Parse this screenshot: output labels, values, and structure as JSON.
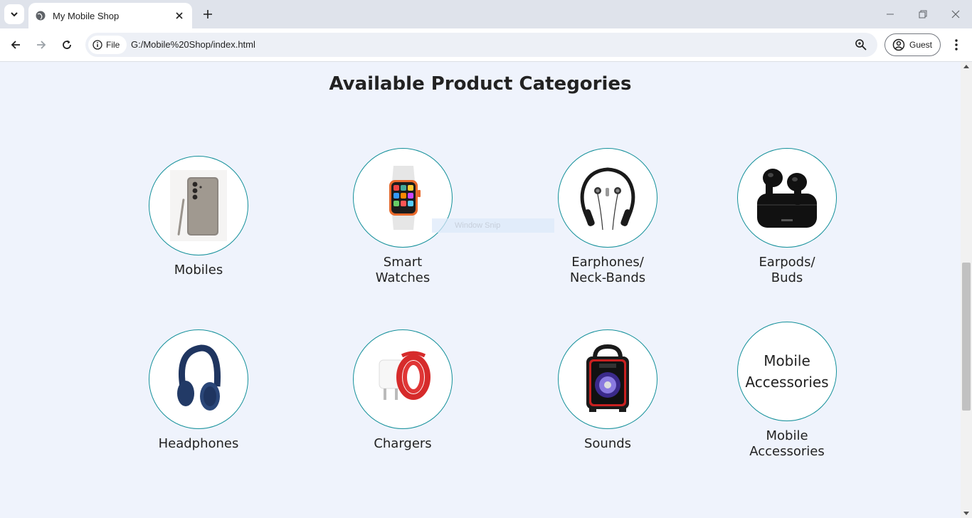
{
  "browser": {
    "tab_title": "My Mobile Shop",
    "file_chip": "File",
    "url": "G:/Mobile%20Shop/index.html",
    "profile_label": "Guest"
  },
  "page": {
    "heading": "Available Product Categories",
    "snip_overlay": "Window Snip",
    "categories": [
      {
        "label_line1": "Mobiles",
        "label_line2": "",
        "icon": "phone-icon"
      },
      {
        "label_line1": "Smart",
        "label_line2": "Watches",
        "icon": "smartwatch-icon"
      },
      {
        "label_line1": "Earphones/",
        "label_line2": "Neck-Bands",
        "icon": "neckband-icon"
      },
      {
        "label_line1": "Earpods/",
        "label_line2": "Buds",
        "icon": "earbuds-icon"
      },
      {
        "label_line1": "Headphones",
        "label_line2": "",
        "icon": "headphones-icon"
      },
      {
        "label_line1": "Chargers",
        "label_line2": "",
        "icon": "charger-icon"
      },
      {
        "label_line1": "Sounds",
        "label_line2": "",
        "icon": "speaker-icon"
      },
      {
        "label_line1": "Mobile",
        "label_line2": "Accessories",
        "circle_line1": "Mobile",
        "circle_line2": "Accessories"
      }
    ]
  },
  "colors": {
    "page_bg": "#eff3fc",
    "circle_border": "#14909a",
    "tabstrip_bg": "#dfe3eb"
  }
}
